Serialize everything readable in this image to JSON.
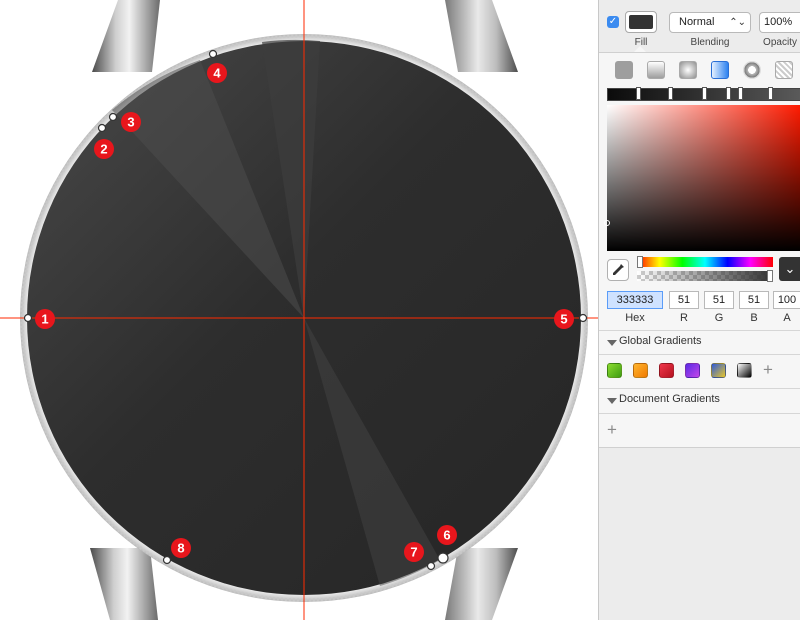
{
  "canvas": {
    "markers": [
      {
        "label": "1"
      },
      {
        "label": "2"
      },
      {
        "label": "3"
      },
      {
        "label": "4"
      },
      {
        "label": "5"
      },
      {
        "label": "6"
      },
      {
        "label": "7"
      },
      {
        "label": "8"
      }
    ],
    "colors": {
      "guide": "#ff2a00",
      "marker": "#e8161c",
      "dial": "#333333"
    }
  },
  "inspector": {
    "fill_enabled": "✓",
    "fill_label": "Fill",
    "fill_color": "#333333",
    "blending": {
      "value": "Normal",
      "label": "Blending",
      "chevron": "⌃⌄"
    },
    "opacity": {
      "value": "100%",
      "label": "Opacity"
    },
    "fill_types": [
      "solid-fill-icon",
      "linear-gradient-icon",
      "radial-gradient-icon",
      "angular-gradient-icon",
      "pattern-fill-icon",
      "noise-fill-icon"
    ],
    "color": {
      "hex": "333333",
      "r": "51",
      "g": "51",
      "b": "51",
      "a": "100",
      "labels": {
        "hex": "Hex",
        "r": "R",
        "g": "G",
        "b": "B",
        "a": "A"
      }
    },
    "global_gradients": {
      "title": "Global Gradients",
      "add": "+",
      "swatches": [
        {
          "name": "green",
          "from": "#8bdc2f",
          "to": "#3f9d12"
        },
        {
          "name": "orange",
          "from": "#ffb52e",
          "to": "#f07a00"
        },
        {
          "name": "red",
          "from": "#f0364a",
          "to": "#b5121f"
        },
        {
          "name": "purple",
          "from": "#5a2be6",
          "to": "#c245e8"
        },
        {
          "name": "rainbow",
          "from": "#2f5bd8",
          "to": "#e8c72a"
        },
        {
          "name": "black",
          "from": "#ffffff",
          "to": "#000000"
        }
      ]
    },
    "document_gradients": {
      "title": "Document Gradients",
      "add": "+"
    }
  }
}
